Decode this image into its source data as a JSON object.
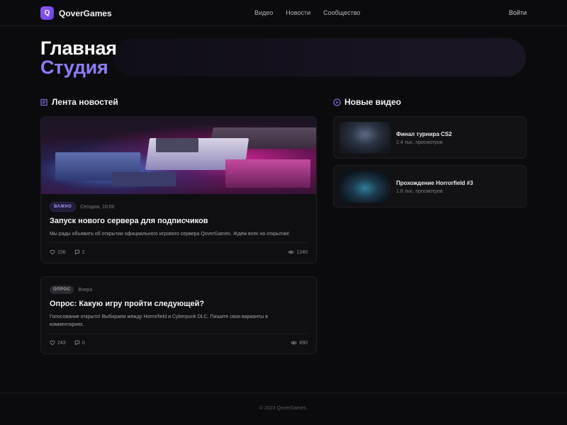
{
  "header": {
    "logo_letter": "Q",
    "brand": "QoverGames",
    "nav": [
      "Видео",
      "Новости",
      "Сообщество"
    ],
    "login": "Войти"
  },
  "hero": {
    "title": "Главная",
    "subtitle": "Студия"
  },
  "news": {
    "section_title": "Лента новостей",
    "items": [
      {
        "badge": "ВАЖНО",
        "time": "Сегодня, 10:00",
        "title": "Запуск нового сервера для подписчиков",
        "text": "Мы рады объявить об открытии официального игрового сервера QoverGames. Ждем всех на открытии!",
        "likes": "156",
        "comments": "2",
        "views": "1240"
      },
      {
        "badge": "ОПРОС",
        "time": "Вчера",
        "title": "Опрос: Какую игру пройти следующей?",
        "text_line1": "Голосование открыто! Выбираем между Horrorfield и Cyberpunk DLC. Пишите свои варианты в",
        "text_line2": "комментариях.",
        "likes": "243",
        "comments": "0",
        "views": "890"
      }
    ]
  },
  "videos": {
    "section_title": "Новые видео",
    "items": [
      {
        "title": "Финал турнира CS2",
        "views": "2.4 тыс. просмотров"
      },
      {
        "title": "Прохождение Horrorfield #3",
        "views": "1.8 тыс. просмотров"
      }
    ]
  },
  "footer": {
    "copyright": "© 2023 QoverGames."
  },
  "colors": {
    "accent": "#8b7cf6",
    "background": "#0b0b0d"
  },
  "icons": [
    "news-feed-icon",
    "play-circle-icon",
    "heart-icon",
    "comment-icon",
    "eye-icon"
  ]
}
